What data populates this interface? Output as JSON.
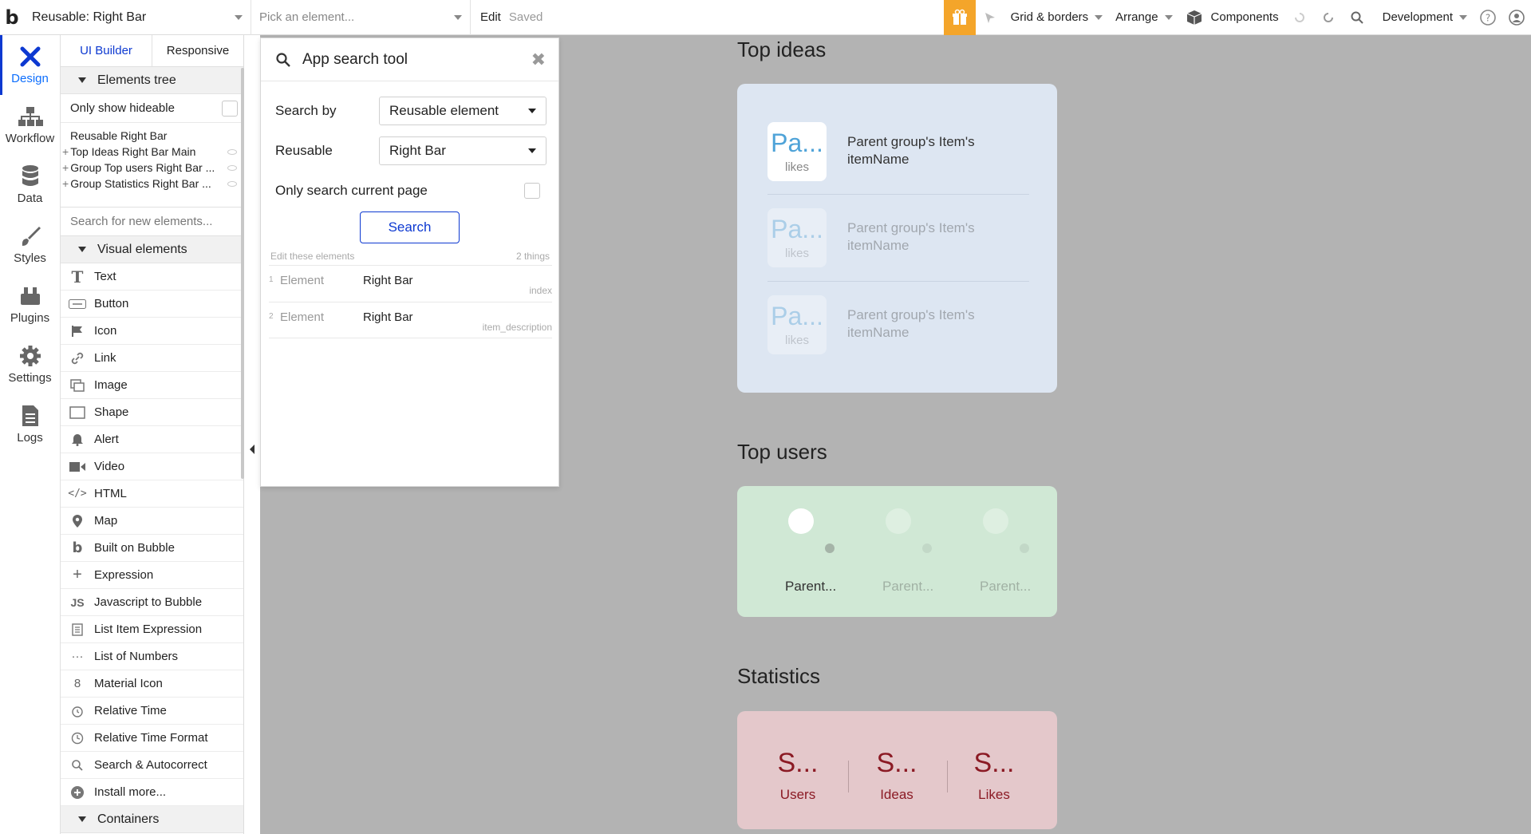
{
  "topbar": {
    "logo": "b",
    "page_select": "Reusable: Right Bar",
    "element_picker_placeholder": "Pick an element...",
    "edit": "Edit",
    "saved": "Saved",
    "grid_borders": "Grid & borders",
    "arrange": "Arrange",
    "components": "Components",
    "environment": "Development",
    "accent_color": "#f4a52a"
  },
  "leftnav": {
    "items": [
      {
        "label": "Design",
        "icon": "design-icon"
      },
      {
        "label": "Workflow",
        "icon": "workflow-icon"
      },
      {
        "label": "Data",
        "icon": "database-icon"
      },
      {
        "label": "Styles",
        "icon": "brush-icon"
      },
      {
        "label": "Plugins",
        "icon": "plugin-icon"
      },
      {
        "label": "Settings",
        "icon": "gear-icon"
      },
      {
        "label": "Logs",
        "icon": "logs-icon"
      }
    ]
  },
  "panel": {
    "tab_ui_builder": "UI Builder",
    "tab_responsive": "Responsive",
    "elements_tree": "Elements tree",
    "only_show_hideable": "Only show hideable",
    "tree_root": "Reusable Right Bar",
    "tree_items": [
      "Top Ideas Right Bar Main",
      "Group Top users Right Bar ...",
      "Group Statistics Right Bar ..."
    ],
    "search_placeholder": "Search for new elements...",
    "visual_elements": "Visual elements",
    "visual_items": [
      "Text",
      "Button",
      "Icon",
      "Link",
      "Image",
      "Shape",
      "Alert",
      "Video",
      "HTML",
      "Map",
      "Built on Bubble",
      "Expression",
      "Javascript to Bubble",
      "List Item Expression",
      "List of Numbers",
      "Material Icon",
      "Relative Time",
      "Relative Time Format",
      "Search & Autocorrect",
      "Install more..."
    ],
    "containers": "Containers"
  },
  "popup": {
    "title": "App search tool",
    "search_by_label": "Search by",
    "search_by_value": "Reusable element",
    "reusable_label": "Reusable",
    "reusable_value": "Right Bar",
    "only_current_page": "Only search current page",
    "search_button": "Search",
    "results_caption": "Edit these elements",
    "results_count": "2 things",
    "results": [
      {
        "num": "1",
        "type": "Element",
        "name": "Right Bar",
        "prop": "index"
      },
      {
        "num": "2",
        "type": "Element",
        "name": "Right Bar",
        "prop": "item_description"
      }
    ]
  },
  "canvas": {
    "top_ideas_title": "Top ideas",
    "ideas": [
      {
        "thumb": "Pa...",
        "likes": "likes",
        "name": "Parent group's Item's itemName"
      },
      {
        "thumb": "Pa...",
        "likes": "likes",
        "name": "Parent group's Item's itemName"
      },
      {
        "thumb": "Pa...",
        "likes": "likes",
        "name": "Parent group's Item's itemName"
      }
    ],
    "top_users_title": "Top users",
    "users": [
      "Parent...",
      "Parent...",
      "Parent..."
    ],
    "statistics_title": "Statistics",
    "stats": [
      {
        "value": "S...",
        "label": "Users"
      },
      {
        "value": "S...",
        "label": "Ideas"
      },
      {
        "value": "S...",
        "label": "Likes"
      }
    ]
  }
}
